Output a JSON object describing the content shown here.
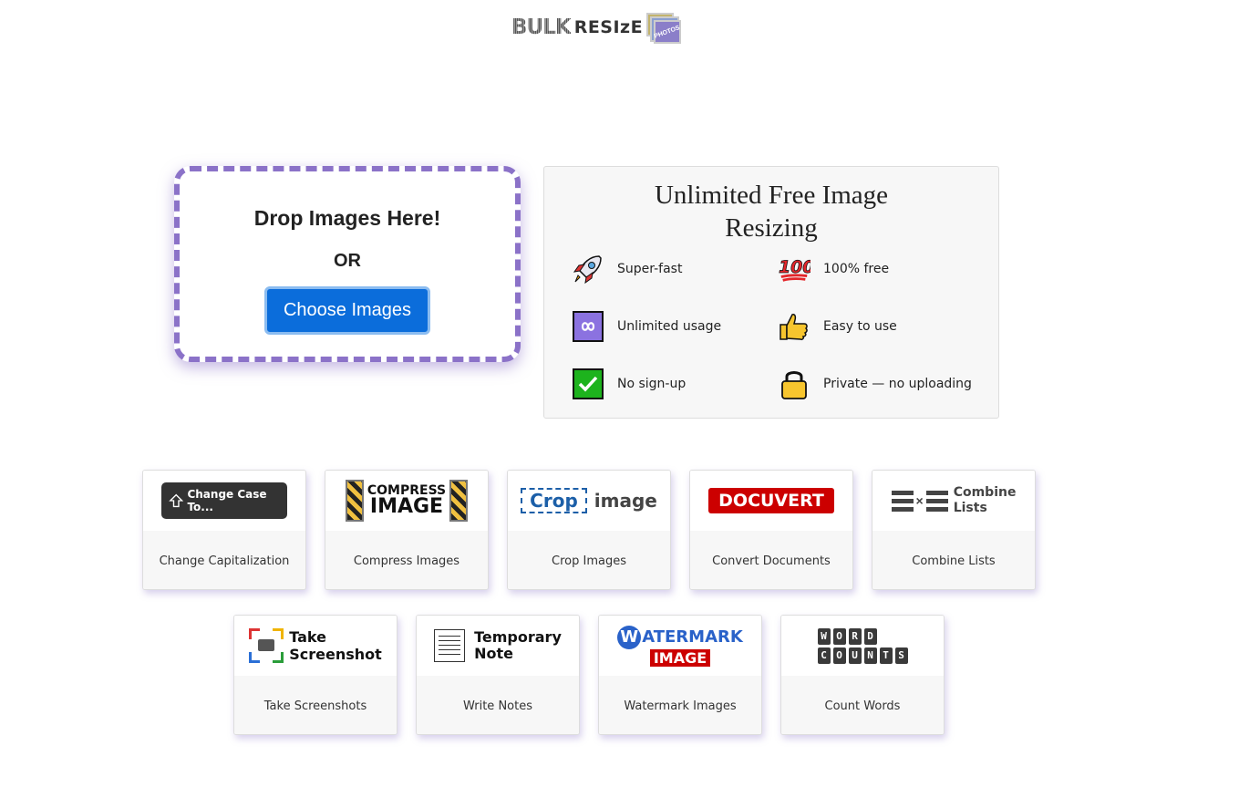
{
  "logo": {
    "bulk": "BULK",
    "resize": "RESIzE",
    "photos": "PHOTOS"
  },
  "dropzone": {
    "title": "Drop Images Here!",
    "or": "OR",
    "button": "Choose Images"
  },
  "features": {
    "title": "Unlimited Free Image Resizing",
    "items": [
      {
        "label": "Super-fast",
        "icon": "rocket-icon"
      },
      {
        "label": "100% free",
        "icon": "hundred-icon"
      },
      {
        "label": "Unlimited usage",
        "icon": "infinity-icon"
      },
      {
        "label": "Easy to use",
        "icon": "thumbs-up-icon"
      },
      {
        "label": "No sign-up",
        "icon": "check-mark-icon"
      },
      {
        "label": "Private — no uploading",
        "icon": "lock-icon"
      }
    ]
  },
  "tools": [
    {
      "caption": "Change Capitalization",
      "art": "Change Case To..."
    },
    {
      "caption": "Compress Images",
      "art_a": "COMPRESS",
      "art_b": "IMAGE"
    },
    {
      "caption": "Crop Images",
      "art_a": "Crop",
      "art_b": "image"
    },
    {
      "caption": "Convert Documents",
      "art": "DOCUVERT"
    },
    {
      "caption": "Combine Lists",
      "art_a": "Combine",
      "art_b": "Lists"
    },
    {
      "caption": "Take Screenshots",
      "art_a": "Take",
      "art_b": "Screenshot"
    },
    {
      "caption": "Write Notes",
      "art_a": "Temporary",
      "art_b": "Note"
    },
    {
      "caption": "Watermark Images",
      "art_a": "ATERMARK",
      "art_w": "W",
      "art_b": "IMAGE"
    },
    {
      "caption": "Count Words",
      "art_a": [
        "W",
        "O",
        "R",
        "D"
      ],
      "art_b": [
        "C",
        "O",
        "U",
        "N",
        "T",
        "S"
      ]
    }
  ],
  "colors": {
    "accent": "#8b72c8",
    "button": "#0b6ddb",
    "docuvert": "#cc0000"
  }
}
